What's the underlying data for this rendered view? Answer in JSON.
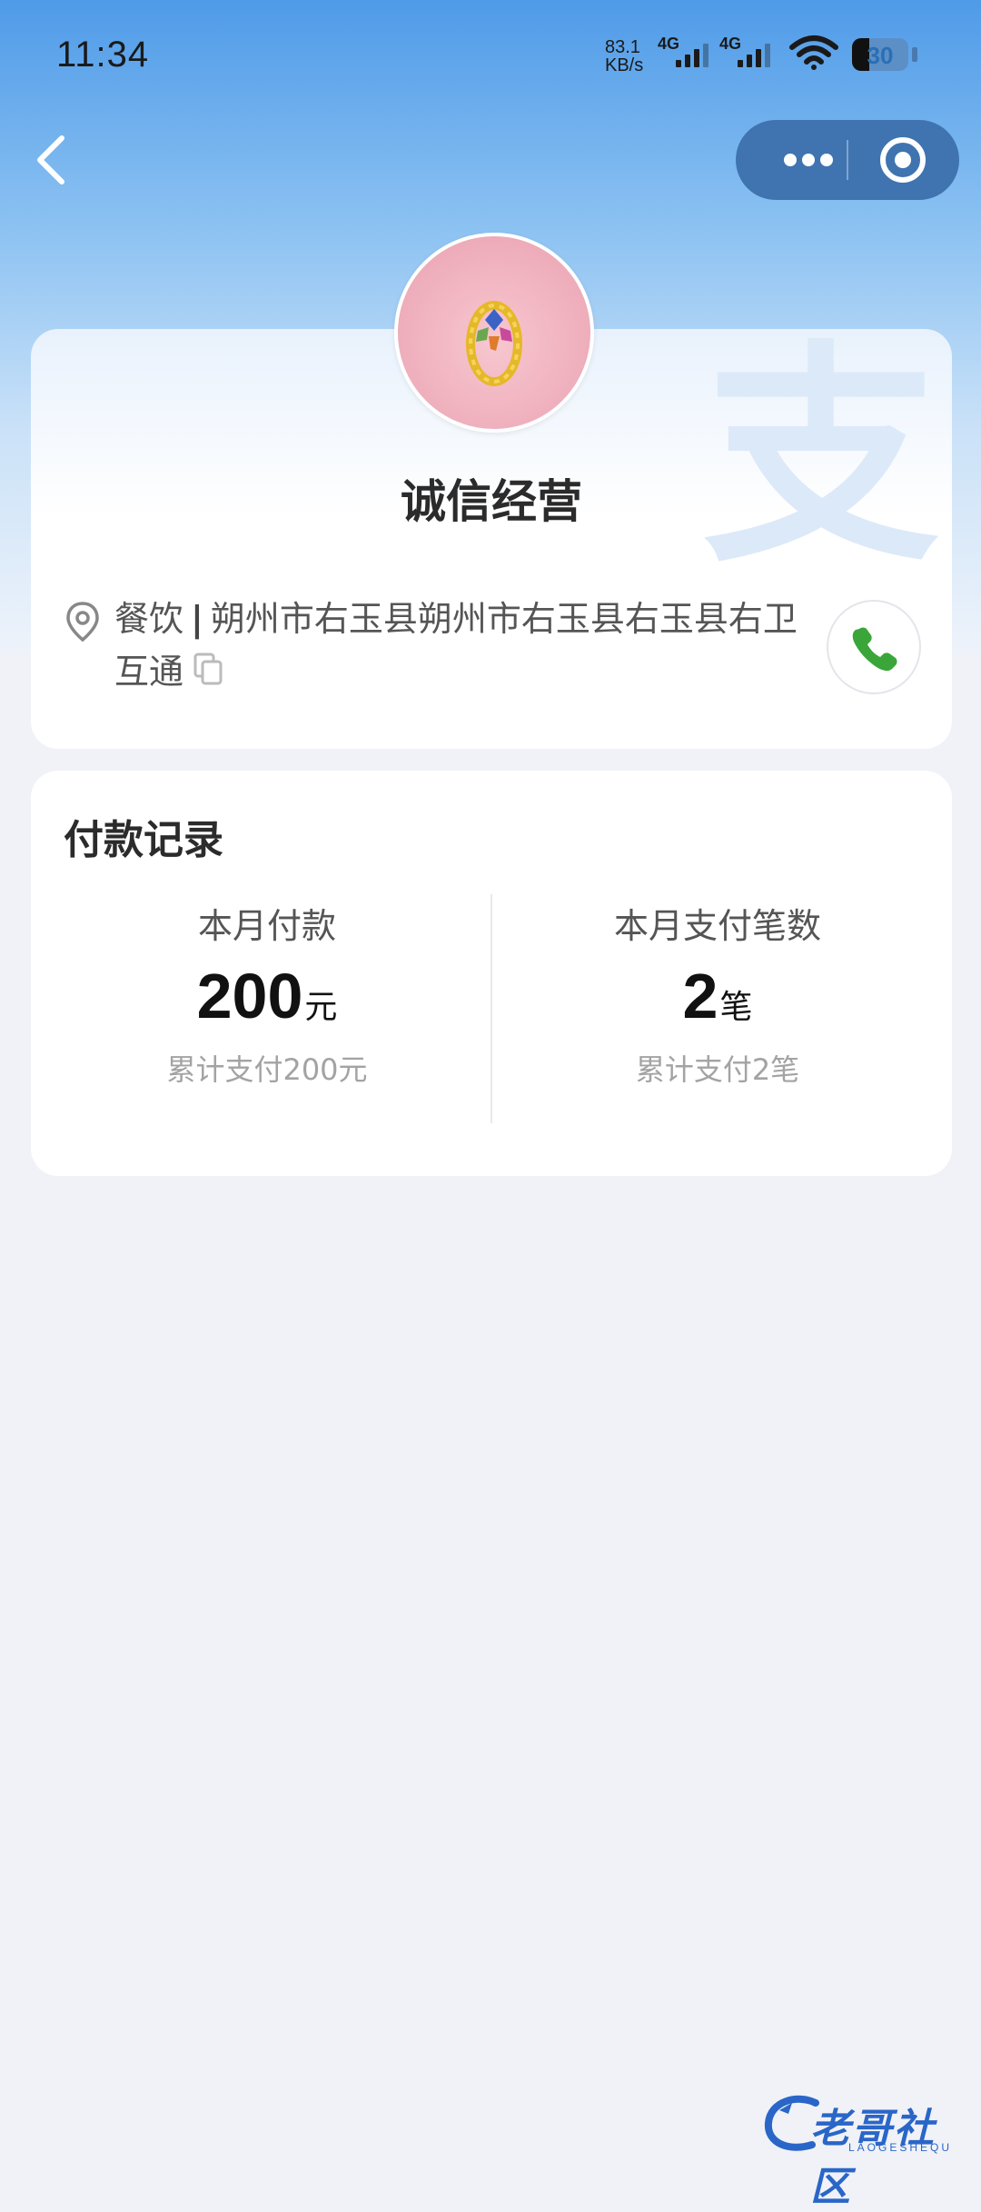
{
  "status_bar": {
    "time": "11:34",
    "net_speed_value": "83.1",
    "net_speed_unit": "KB/s",
    "signal_1_label": "4G",
    "signal_2_label": "4G",
    "battery_level": "30"
  },
  "store": {
    "name": "诚信经营",
    "category": "餐饮",
    "address": "朔州市右玉县朔州市右玉县右玉县右卫互通"
  },
  "payment": {
    "title": "付款记录",
    "month_amount_label": "本月付款",
    "month_amount_value": "200",
    "month_amount_unit": "元",
    "month_amount_total": "累计支付200元",
    "month_count_label": "本月支付笔数",
    "month_count_value": "2",
    "month_count_unit": "笔",
    "month_count_total": "累计支付2笔"
  },
  "watermark": {
    "text": "老哥社区",
    "sub": "LAOGESHEQU"
  },
  "colors": {
    "accent": "#2a66c8",
    "phone_green": "#3aa639",
    "capsule": "#3f74b0"
  },
  "icons": [
    "back-arrow-icon",
    "more-dots-icon",
    "target-close-icon",
    "location-pin-icon",
    "copy-icon",
    "phone-icon",
    "wifi-icon",
    "battery-icon"
  ]
}
